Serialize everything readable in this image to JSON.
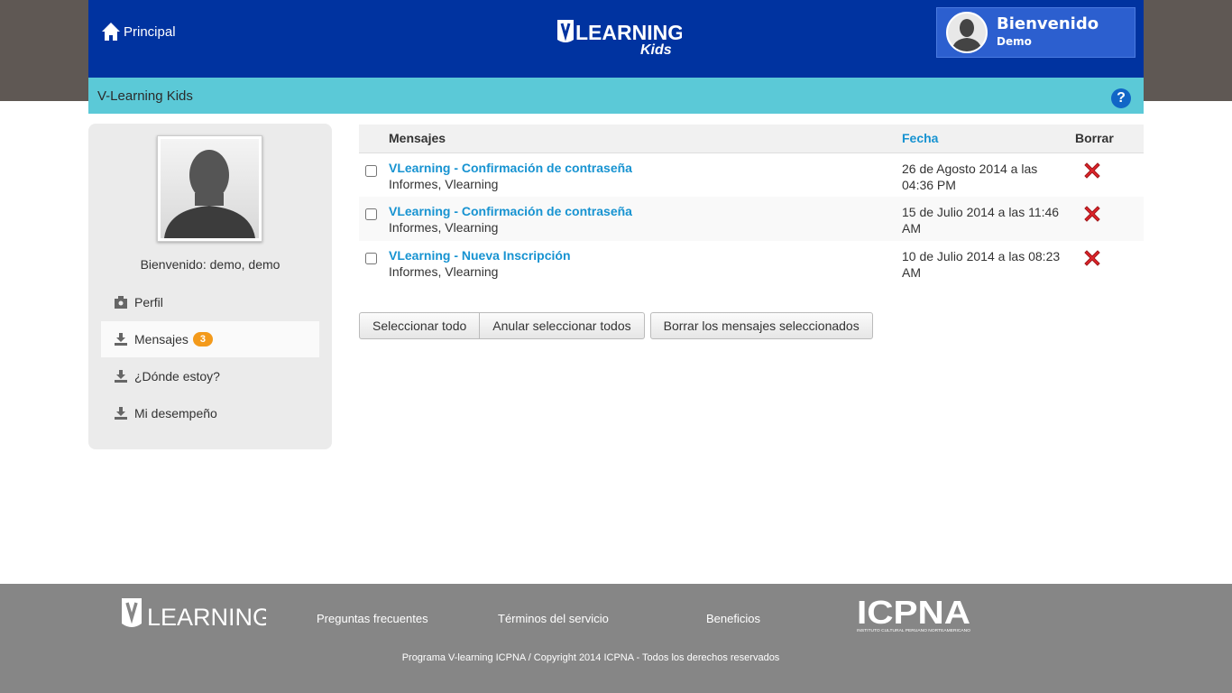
{
  "header": {
    "home_label": "Principal",
    "logo_main": "LEARNING",
    "logo_sub": "Kids",
    "welcome_title": "Bienvenido",
    "welcome_user": "Demo"
  },
  "subbar": {
    "title": "V-Learning Kids",
    "help": "?"
  },
  "sidebar": {
    "greeting": "Bienvenido: demo, demo",
    "items": [
      {
        "label": "Perfil",
        "icon": "profile-icon"
      },
      {
        "label": "Mensajes",
        "badge": "3",
        "icon": "inbox-icon"
      },
      {
        "label": "¿Dónde estoy?",
        "icon": "inbox-icon"
      },
      {
        "label": "Mi desempeño",
        "icon": "inbox-icon"
      }
    ]
  },
  "messages": {
    "columns": {
      "message": "Mensajes",
      "date": "Fecha",
      "delete": "Borrar"
    },
    "rows": [
      {
        "title": "VLearning - Confirmación de contraseña",
        "from": "Informes, Vlearning",
        "date": "26 de Agosto 2014 a las 04:36 PM"
      },
      {
        "title": "VLearning - Confirmación de contraseña",
        "from": "Informes, Vlearning",
        "date": "15 de Julio 2014 a las 11:46 AM"
      },
      {
        "title": "VLearning - Nueva Inscripción",
        "from": "Informes, Vlearning",
        "date": "10 de Julio 2014 a las 08:23 AM"
      }
    ],
    "buttons": {
      "select_all": "Seleccionar todo",
      "deselect_all": "Anular seleccionar todos",
      "delete_selected": "Borrar los mensajes seleccionados"
    }
  },
  "footer": {
    "logo": "LEARNING",
    "links": [
      "Preguntas frecuentes",
      "Términos del servicio",
      "Beneficios"
    ],
    "partner_logo": "ICPNA",
    "partner_sub": "INSTITUTO CULTURAL PERUANO NORTEAMERICANO",
    "copyright": "Programa V-learning ICPNA / Copyright 2014 ICPNA - Todos los derechos reservados"
  },
  "colors": {
    "header_bg": "#0033a0",
    "subbar_bg": "#5bc9d7",
    "link": "#1793d1",
    "badge": "#f39a1b",
    "footer_bg": "#868686"
  }
}
